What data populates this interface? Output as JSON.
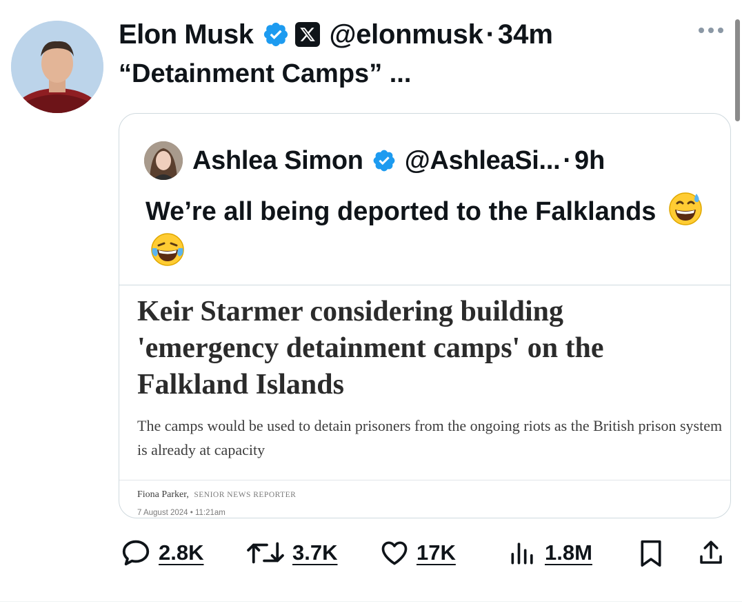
{
  "post": {
    "author_name": "Elon Musk",
    "handle": "@elonmusk",
    "separator": "·",
    "time": "34m",
    "text": "“Detainment Camps” ...",
    "more_icon": "more-horizontal-icon",
    "verified_icon": "verified-badge-icon",
    "affiliation_icon": "x-logo-icon"
  },
  "quote": {
    "author_name": "Ashlea Simon",
    "handle": "@AshleaSi...",
    "separator": "·",
    "time": "9h",
    "text": "We’re all being deported to the Falklands",
    "emojis": [
      "grinning-face-with-sweat-emoji",
      "face-with-tears-of-joy-emoji"
    ],
    "article": {
      "headline": "Keir Starmer considering building 'emergency detainment camps' on the Falkland Islands",
      "standfirst": "The camps would be used to detain prisoners from the ongoing riots as the British prison system is already at capacity",
      "author": "Fiona Parker,",
      "author_role": "SENIOR NEWS REPORTER",
      "date": "7 August 2024 • 11:21am"
    }
  },
  "actions": {
    "replies": "2.8K",
    "reposts": "3.7K",
    "likes": "17K",
    "views": "1.8M"
  },
  "colors": {
    "verified_blue": "#1d9bf0",
    "text": "#0f1419",
    "border": "#cfd9de",
    "icon_gray": "#536471"
  }
}
